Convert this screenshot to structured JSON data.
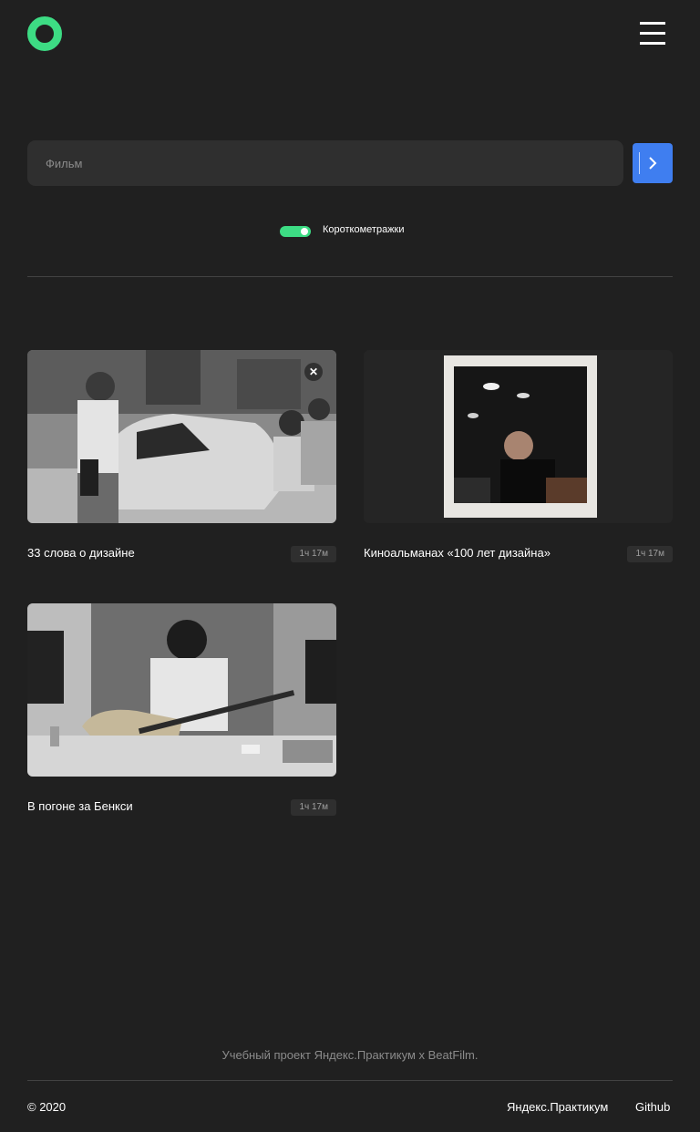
{
  "header": {
    "logo_icon": "ring-logo-icon",
    "menu_icon": "hamburger-menu-icon"
  },
  "search": {
    "placeholder": "Фильм",
    "value": "",
    "button_icon": "chevron-right-icon"
  },
  "filter": {
    "label": "Короткометражки",
    "enabled": true
  },
  "movies": [
    {
      "title": "33 слова о дизайне",
      "duration": "1ч 17м",
      "remove_icon": "close-icon"
    },
    {
      "title": "Киноальманах «100 лет дизайна»",
      "duration": "1ч 17м"
    },
    {
      "title": "В погоне за Бенкси",
      "duration": "1ч 17м"
    }
  ],
  "footer": {
    "note": "Учебный проект Яндекс.Практикум х BeatFilm.",
    "copyright": "© 2020",
    "links": [
      "Яндекс.Практикум",
      "Github"
    ]
  },
  "colors": {
    "background": "#202020",
    "accent": "#3ddc84",
    "button": "#3f7ef0",
    "input": "#2f2f2f",
    "muted_text": "#8b8b8b"
  }
}
